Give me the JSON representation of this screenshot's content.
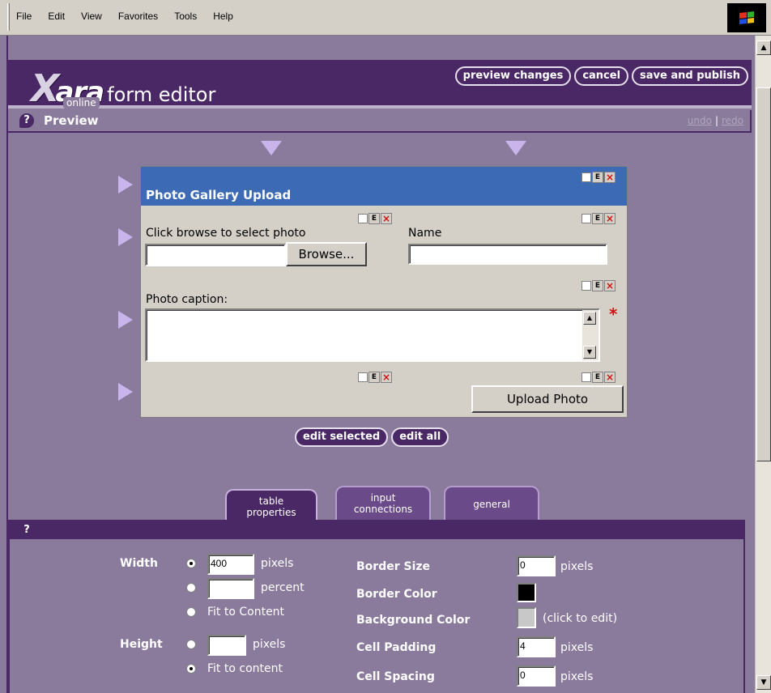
{
  "menu": {
    "items": [
      "File",
      "Edit",
      "View",
      "Favorites",
      "Tools",
      "Help"
    ]
  },
  "header": {
    "logo_x": "X",
    "logo_rest": "ara",
    "logo_online": "online",
    "app_name": "form editor",
    "preview_changes": "preview changes",
    "cancel": "cancel",
    "save_publish": "save and publish"
  },
  "preview": {
    "help": "?",
    "title": "Preview",
    "undo": "undo",
    "separator": "|",
    "redo": "redo"
  },
  "form": {
    "title": "Photo Gallery Upload",
    "browse_label": "Click browse to select photo",
    "browse_button": "Browse...",
    "name_label": "Name",
    "caption_label": "Photo caption:",
    "required_mark": "*",
    "upload_button": "Upload Photo",
    "ctrl_e": "E",
    "ctrl_x": "×"
  },
  "edit": {
    "edit_selected": "edit selected",
    "edit_all": "edit all"
  },
  "tabs": [
    {
      "line1": "table",
      "line2": "properties",
      "active": true
    },
    {
      "line1": "input",
      "line2": "connections",
      "active": false
    },
    {
      "line1": "general",
      "line2": "",
      "active": false
    }
  ],
  "props": {
    "help": "?",
    "width_label": "Width",
    "width_value": "400",
    "pixels": "pixels",
    "percent": "percent",
    "fit_content": "Fit to Content",
    "height_label": "Height",
    "height_fit": "Fit to content",
    "border_size_label": "Border Size",
    "border_size_value": "0",
    "border_color_label": "Border Color",
    "border_color": "#000000",
    "bg_color_label": "Background Color",
    "bg_color": "#c8c8c8",
    "bg_click": "(click to edit)",
    "cell_padding_label": "Cell Padding",
    "cell_padding_value": "4",
    "cell_spacing_label": "Cell Spacing",
    "cell_spacing_value": "0"
  }
}
